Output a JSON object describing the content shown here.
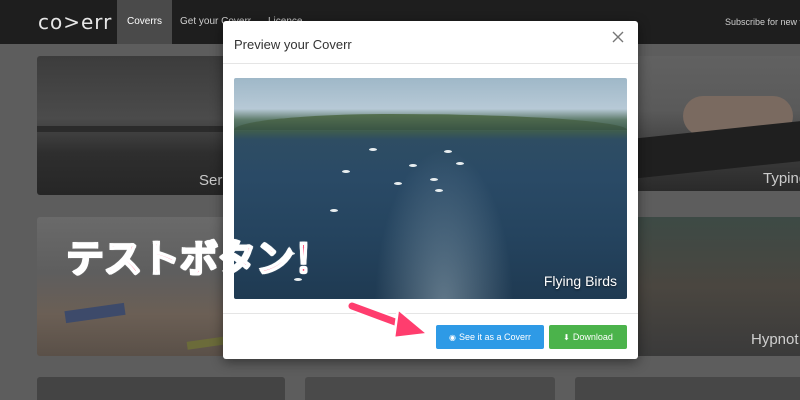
{
  "navbar": {
    "logo": "co>err",
    "items": [
      "Coverrs",
      "Get your Coverr",
      "Licence"
    ],
    "subscribe": "Subscribe for new v"
  },
  "grid": {
    "cards": [
      "Sere",
      "Typing",
      "",
      "Hypnot",
      "",
      "",
      ""
    ]
  },
  "modal": {
    "title": "Preview your Coverr",
    "close_icon": "close-icon",
    "preview_caption": "Flying Birds",
    "see_button": "See it as a Coverr",
    "see_icon": "eye-icon",
    "download_button": "Download",
    "download_icon": "download-icon"
  },
  "annotation": {
    "text": "テストボタン！"
  },
  "colors": {
    "nav_bg": "#1e1e1e",
    "accent_blue": "#2e9ae6",
    "accent_green": "#4bb34b",
    "annotation": "#ff3d6e"
  }
}
